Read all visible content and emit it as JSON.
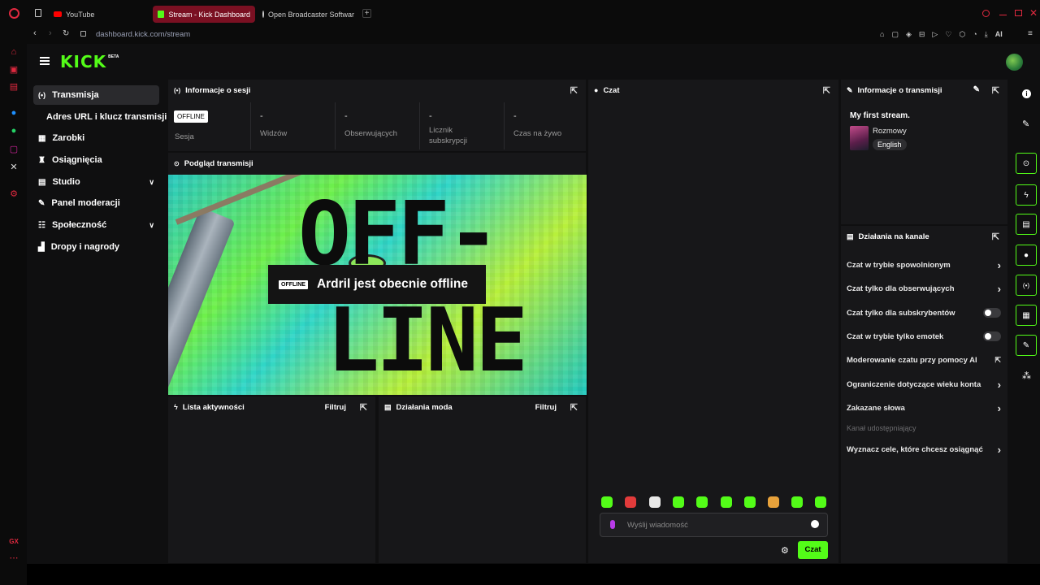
{
  "browser": {
    "tabs": [
      {
        "label": "YouTube"
      },
      {
        "label": "Stream - Kick Dashboard"
      },
      {
        "label": "Open Broadcaster Softwar"
      }
    ],
    "url": "dashboard.kick.com/stream",
    "ai_label": "AI",
    "gx_label": "GX"
  },
  "brand": {
    "logo": "KICK",
    "beta": "BETA"
  },
  "nav": [
    {
      "label": "Transmisja",
      "icon": "broadcast-icon"
    },
    {
      "label": "Adres URL i klucz transmisji",
      "icon": ""
    },
    {
      "label": "Zarobki",
      "icon": "earnings-icon"
    },
    {
      "label": "Osiągnięcia",
      "icon": "trophy-icon"
    },
    {
      "label": "Studio",
      "icon": "studio-icon"
    },
    {
      "label": "Panel moderacji",
      "icon": "wrench-icon"
    },
    {
      "label": "Społeczność",
      "icon": "community-icon"
    },
    {
      "label": "Dropy i nagrody",
      "icon": "drops-icon"
    }
  ],
  "session": {
    "title": "Informacje o sesji",
    "badge": "OFFLINE",
    "badge_label": "Sesja",
    "stats": [
      {
        "value": "-",
        "label": "Widzów"
      },
      {
        "value": "-",
        "label": "Obserwujących"
      },
      {
        "value": "-",
        "label": "Licznik subskrypcji"
      },
      {
        "value": "-",
        "label": "Czas na żywo"
      }
    ]
  },
  "preview": {
    "title": "Podgląd transmisji",
    "badge": "OFFLINE",
    "message": "Ardril jest obecnie offline",
    "art_top": "OFF-",
    "art_bottom": "LINE"
  },
  "activity": {
    "title": "Lista aktywności",
    "filter": "Filtruj"
  },
  "modactions": {
    "title": "Działania moda",
    "filter": "Filtruj"
  },
  "chat": {
    "title": "Czat",
    "placeholder": "Wyślij wiadomość",
    "send": "Czat"
  },
  "stream_info": {
    "title": "Informacje o transmisji",
    "stream_title": "My first stream.",
    "category": "Rozmowy",
    "language": "English"
  },
  "channel": {
    "title": "Działania na kanale",
    "items": [
      {
        "label": "Czat w trybie spowolnionym",
        "control": "chevron"
      },
      {
        "label": "Czat tylko dla obserwujących",
        "control": "chevron"
      },
      {
        "label": "Czat tylko dla subskrybentów",
        "control": "toggle",
        "on": false
      },
      {
        "label": "Czat w trybie tylko emotek",
        "control": "toggle",
        "on": false
      },
      {
        "label": "Moderowanie czatu przy pomocy AI",
        "control": "external"
      },
      {
        "label": "Ograniczenie dotyczące wieku konta",
        "control": "chevron"
      },
      {
        "label": "Zakazane słowa",
        "control": "chevron"
      }
    ],
    "section_label": "Kanał udostępniający",
    "goals": "Wyznacz cele, które chcesz osiągnąć"
  },
  "colors": {
    "accent": "#53fc18",
    "active_tab": "#7a1022"
  }
}
